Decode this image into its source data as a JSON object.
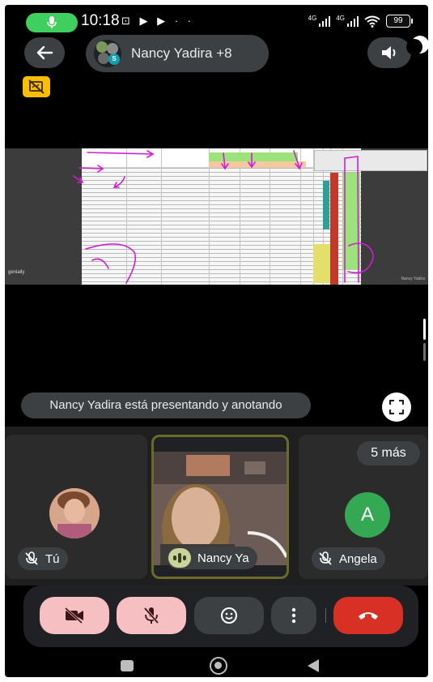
{
  "status_bar": {
    "time": "10:18",
    "notification_icons": "⊡ ▶ ▶ · ·",
    "signal_label_1": "4G",
    "signal_label_2": "4G",
    "battery_level": "99",
    "mic_active_color": "#3ecf5f"
  },
  "header": {
    "call_title": "Nancy Yadira +8",
    "avatar_initial": "S",
    "back_icon": "arrow-left-icon",
    "speaker_icon": "speaker-icon",
    "recording_icon": "cast-off-icon",
    "recording_badge_color": "#fbbc04"
  },
  "presentation": {
    "app_watermark": "genially",
    "caption": "Nancy Yadira",
    "annotation_color": "#d01dd6"
  },
  "banner": {
    "presenting_text": "Nancy Yadira está presentando y anotando",
    "fullscreen_icon": "fullscreen-icon"
  },
  "tiles": {
    "you": {
      "name": "Tú",
      "mic_state": "muted"
    },
    "presenter": {
      "name": "Nancy Ya",
      "speaking": true
    },
    "angela": {
      "name": "Angela",
      "initial": "A",
      "more_label": "5 más",
      "mic_state": "muted",
      "avatar_color": "#34a853"
    }
  },
  "controls": {
    "camera_icon": "camera-off-icon",
    "mic_icon": "mic-off-icon",
    "reactions_icon": "emoji-icon",
    "more_icon": "more-vert-icon",
    "hangup_icon": "call-end-icon",
    "hangup_color": "#d93025",
    "muted_button_color": "#f6c0c3"
  },
  "navigation": {
    "recents_icon": "square-icon",
    "home_icon": "circle-icon",
    "back_icon": "triangle-back-icon"
  }
}
